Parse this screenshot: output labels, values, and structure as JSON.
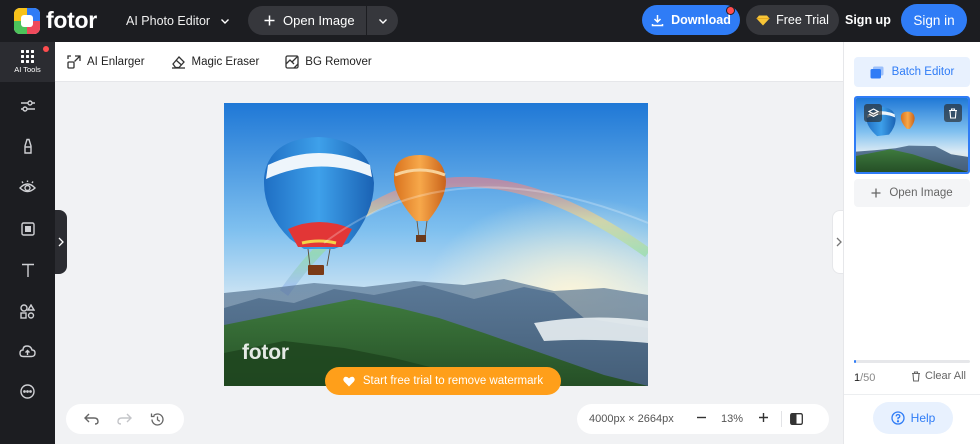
{
  "header": {
    "brand": "fotor",
    "menu_label": "AI Photo Editor",
    "open_image_label": "Open Image",
    "download_label": "Download",
    "free_trial_label": "Free Trial",
    "signup_label": "Sign up",
    "signin_label": "Sign in"
  },
  "sidebar": {
    "active_label": "AI Tools",
    "items": [
      "adjust-icon",
      "beauty-icon",
      "eye-icon",
      "frame-icon",
      "text-icon",
      "elements-icon",
      "cloud-icon",
      "more-icon"
    ]
  },
  "toolbar": {
    "tools": [
      {
        "label": "AI Enlarger",
        "icon": "enlarge-icon"
      },
      {
        "label": "Magic Eraser",
        "icon": "eraser-icon"
      },
      {
        "label": "BG Remover",
        "icon": "bg-remover-icon"
      }
    ]
  },
  "canvas": {
    "watermark": "fotor",
    "trial_banner": "Start free trial to remove watermark",
    "dimensions": "4000px × 2664px",
    "zoom": "13%"
  },
  "right_panel": {
    "batch_label": "Batch Editor",
    "open_image_label": "Open Image",
    "count_current": "1",
    "count_total": "/50",
    "clear_label": "Clear All",
    "progress": 0.02,
    "help_label": "Help"
  },
  "colors": {
    "accent": "#2f7cf6",
    "dark": "#1c1d21",
    "trial": "#ff9f1a"
  }
}
